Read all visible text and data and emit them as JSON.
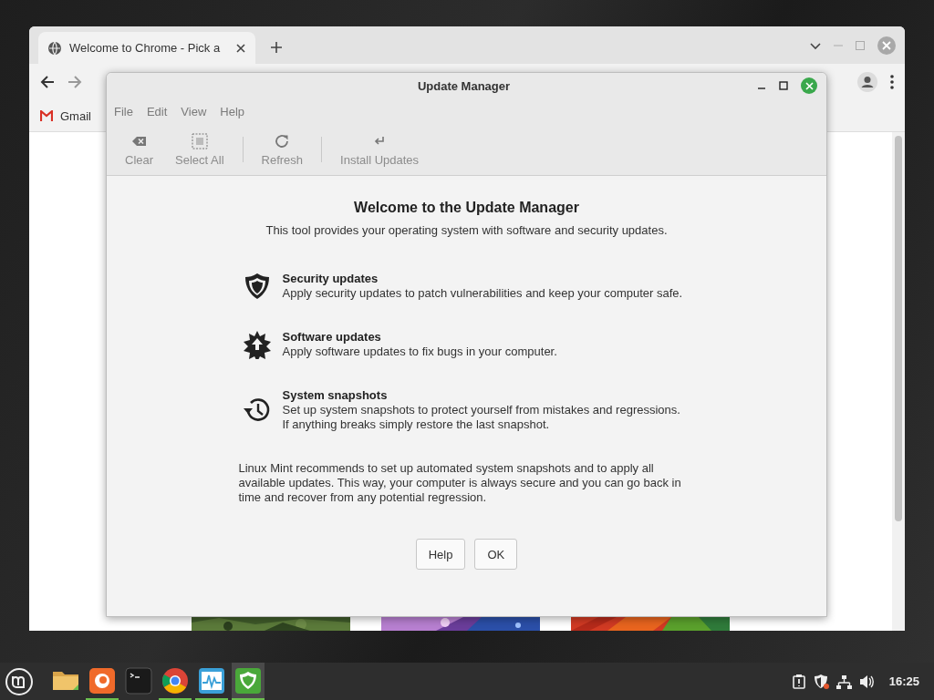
{
  "browser": {
    "tab": {
      "title": "Welcome to Chrome - Pick a"
    },
    "bookmarks": [
      {
        "label": "Gmail"
      }
    ]
  },
  "dialog": {
    "title": "Update Manager",
    "menu": [
      "File",
      "Edit",
      "View",
      "Help"
    ],
    "toolbar": [
      {
        "kind": "clear",
        "label": "Clear",
        "disabled": true
      },
      {
        "kind": "select",
        "label": "Select All",
        "disabled": true
      },
      {
        "kind": "refresh",
        "label": "Refresh",
        "disabled": true
      },
      {
        "kind": "install",
        "label": "Install Updates",
        "disabled": true
      }
    ],
    "heading": "Welcome to the Update Manager",
    "subtitle": "This tool provides your operating system with software and security updates.",
    "features": [
      {
        "kind": "security",
        "title": "Security updates",
        "text": "Apply security updates to patch vulnerabilities and keep your computer safe."
      },
      {
        "kind": "software",
        "title": "Software updates",
        "text": "Apply software updates to fix bugs in your computer."
      },
      {
        "kind": "snapshots",
        "title": "System snapshots",
        "text": "Set up system snapshots to protect yourself from mistakes and regressions. If anything breaks simply restore the last snapshot."
      }
    ],
    "note": "Linux Mint recommends to set up automated system snapshots and to apply all available updates. This way, your computer is always secure and you can go back in time and recover from any potential regression.",
    "buttons": [
      "Help",
      "OK"
    ]
  },
  "taskbar": {
    "apps": [
      {
        "kind": "files",
        "running": false,
        "active": false
      },
      {
        "kind": "firefox",
        "running": true,
        "active": false
      },
      {
        "kind": "terminal",
        "running": false,
        "active": false
      },
      {
        "kind": "chrome",
        "running": true,
        "active": false
      },
      {
        "kind": "monitor",
        "running": true,
        "active": false
      },
      {
        "kind": "update",
        "running": true,
        "active": true
      }
    ],
    "clock": "16:25"
  }
}
